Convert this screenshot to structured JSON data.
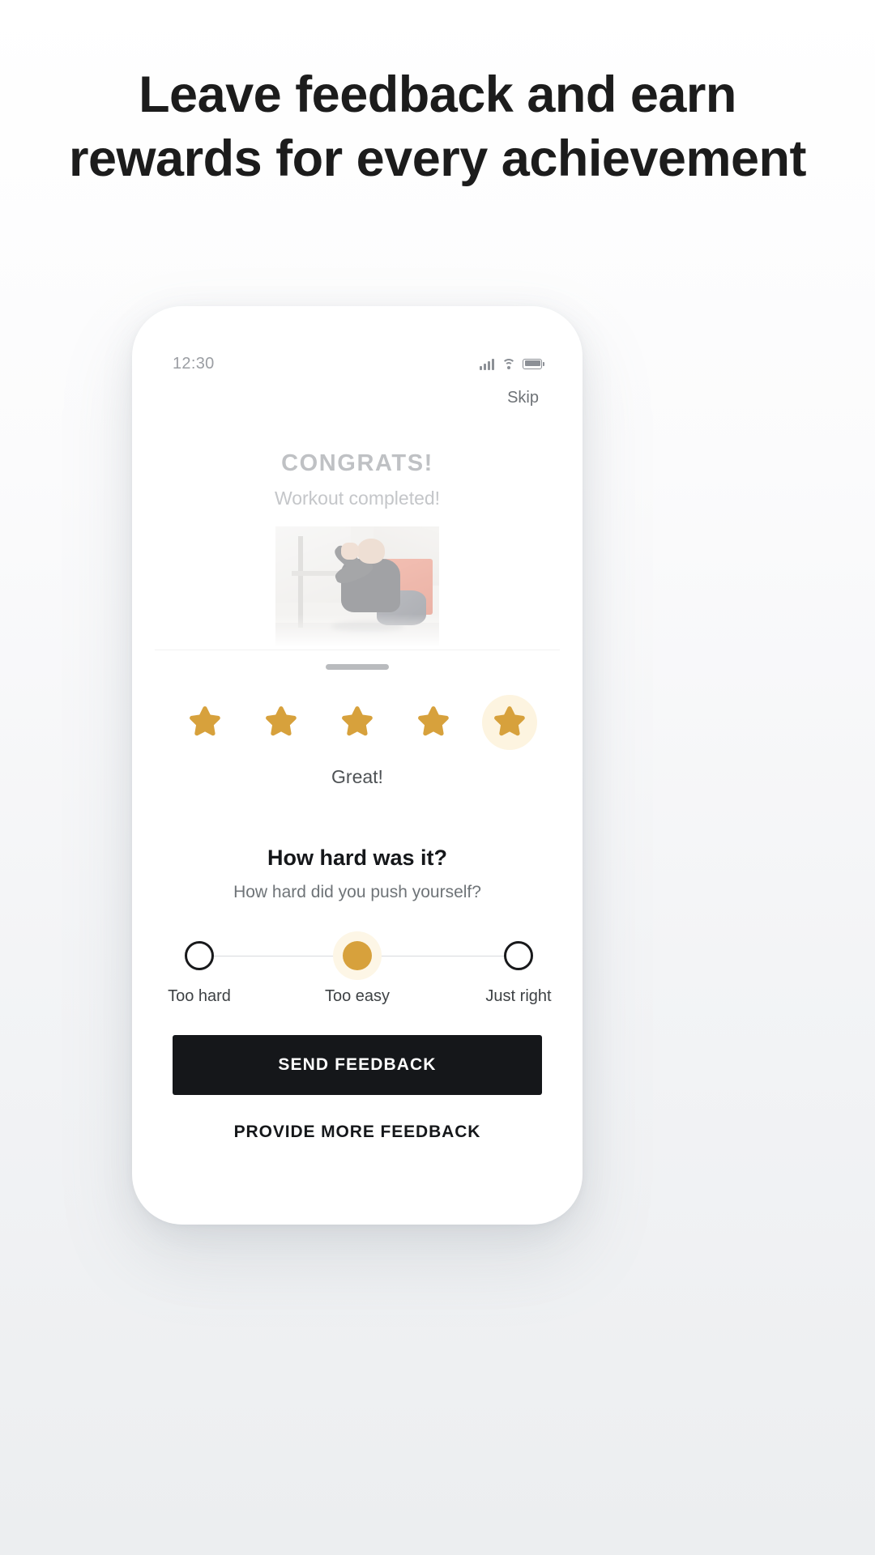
{
  "headline": "Leave feedback and earn rewards for every achievement",
  "phone": {
    "status_bar": {
      "time": "12:30",
      "signal_icon": "signal-bars-icon",
      "wifi_icon": "wifi-icon",
      "battery_icon": "battery-full-icon"
    },
    "skip_label": "Skip",
    "congrats": {
      "title": "CONGRATS!",
      "subtitle": "Workout completed!"
    },
    "photo_alt": "athlete crouching after workout",
    "rating": {
      "max": 5,
      "value": 5,
      "label": "Great!",
      "star_color": "#d7a13c",
      "highlight_color": "#fdf4e0"
    },
    "difficulty": {
      "title": "How hard was it?",
      "subtitle": "How hard did you push yourself?",
      "selected_index": 0,
      "options": [
        {
          "label": "Too easy"
        },
        {
          "label": "Just right"
        },
        {
          "label": "Too hard"
        }
      ]
    },
    "primary_button": "SEND FEEDBACK",
    "secondary_button": "PROVIDE MORE FEEDBACK"
  }
}
